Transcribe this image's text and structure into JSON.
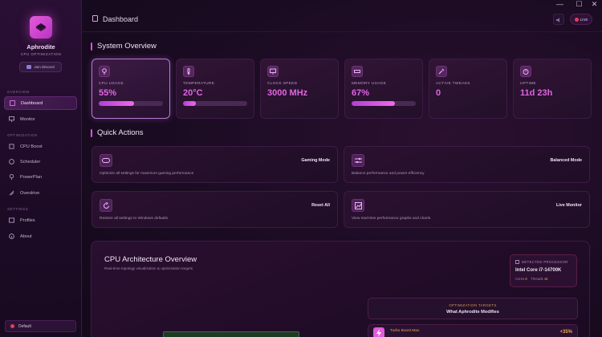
{
  "window": {
    "minimize": "—",
    "maximize": "☐",
    "close": "✕"
  },
  "sidebar": {
    "app_name": "Aphrodite",
    "app_subtitle": "CPU OPTIMIZATION",
    "discord_button": "Join Discord",
    "sections": [
      "OVERVIEW",
      "OPTIMIZATION",
      "SETTINGS"
    ],
    "items": [
      {
        "label": "Dashboard",
        "icon": "dashboard-icon",
        "active": true
      },
      {
        "label": "Monitor",
        "icon": "monitor-icon",
        "active": false
      },
      {
        "label": "CPU Boost",
        "icon": "cpu-icon",
        "active": false
      },
      {
        "label": "Scheduler",
        "icon": "clock-icon",
        "active": false
      },
      {
        "label": "PowerPlan",
        "icon": "bulb-icon",
        "active": false
      },
      {
        "label": "Overdrive",
        "icon": "rocket-icon",
        "active": false
      },
      {
        "label": "Profiles",
        "icon": "profile-icon",
        "active": false
      },
      {
        "label": "About",
        "icon": "info-icon",
        "active": false
      }
    ],
    "profile_selector": "Default"
  },
  "header": {
    "title": "Dashboard",
    "live_badge": "LIVE"
  },
  "system_overview": {
    "title": "System Overview",
    "cards": [
      {
        "label": "CPU USAGE",
        "value": "55%",
        "progress": 0.55,
        "icon": "cpu-icon"
      },
      {
        "label": "TEMPERATURE",
        "value": "20°C",
        "progress": 0.2,
        "icon": "thermometer-icon"
      },
      {
        "label": "CLOCK SPEED",
        "value": "3000 MHz",
        "progress": null,
        "icon": "monitor-icon"
      },
      {
        "label": "MEMORY USAGE",
        "value": "67%",
        "progress": 0.67,
        "icon": "memory-icon"
      },
      {
        "label": "ACTIVE TWEAKS",
        "value": "0",
        "progress": null,
        "icon": "wrench-icon"
      },
      {
        "label": "UPTIME",
        "value": "11d 23h",
        "progress": null,
        "icon": "timer-icon"
      }
    ]
  },
  "quick_actions": {
    "title": "Quick Actions",
    "items": [
      {
        "title": "Gaming Mode",
        "description": "Optimize all settings for maximum gaming performance",
        "icon": "gamepad-icon"
      },
      {
        "title": "Balanced Mode",
        "description": "Balance performance and power efficiency",
        "icon": "sliders-icon"
      },
      {
        "title": "Reset All",
        "description": "Restore all settings to Windows defaults",
        "icon": "reset-icon"
      },
      {
        "title": "Live Monitor",
        "description": "View real-time performance graphs and charts",
        "icon": "chart-icon"
      }
    ]
  },
  "architecture": {
    "title": "CPU Architecture Overview",
    "subtitle": "Real-time topology visualization & optimization targets",
    "detected_label": "DETECTED PROCESSOR",
    "processor": "Intel Core i7-14700K",
    "cores_label": "Cores",
    "cores": "8",
    "threads_label": "Threads",
    "threads": "16",
    "targets_label": "OPTIMIZATION TARGETS",
    "targets_title": "What Aphrodite Modifies",
    "turbo_label": "Turbo Boost Max",
    "turbo_value": "+35%"
  },
  "colors": {
    "accent": "#e24fd4",
    "value": "#dd66e0",
    "orange": "#f0a64d",
    "live_dot": "#e0405a"
  }
}
